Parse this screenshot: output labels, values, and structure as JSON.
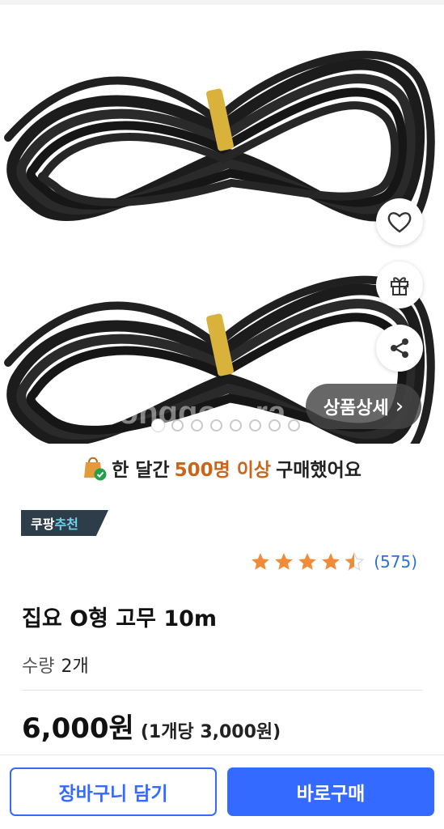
{
  "gallery": {
    "detail_button_label": "상품상세",
    "detail_chevron": "›",
    "watermark": "Joonggonara",
    "page_count": 8,
    "current_page": 1
  },
  "icons": {
    "wishlist": "heart-icon",
    "gift": "gift-icon",
    "share": "share-icon",
    "purchase": "shopping-bag-check-icon"
  },
  "purchase_banner": {
    "prefix": "한 달간",
    "highlight": "500명 이상",
    "suffix": "구매했어요"
  },
  "badge": {
    "part1": "쿠팡",
    "part2": "추천"
  },
  "rating": {
    "stars": 4.5,
    "count_label": "(575)"
  },
  "product": {
    "title": "집요 O형 고무 10m",
    "quantity_label": "수량",
    "quantity_value": "2개",
    "price": "6,000원",
    "unit_price": "(1개당 3,000원)"
  },
  "actions": {
    "cart_label": "장바구니 담기",
    "buy_label": "바로구매"
  },
  "colors": {
    "brand_blue": "#346aff",
    "highlight_orange": "#c8661b",
    "star_orange": "#f28b37",
    "review_blue": "#2f6fd6",
    "badge_navy": "#2d3e4a"
  }
}
